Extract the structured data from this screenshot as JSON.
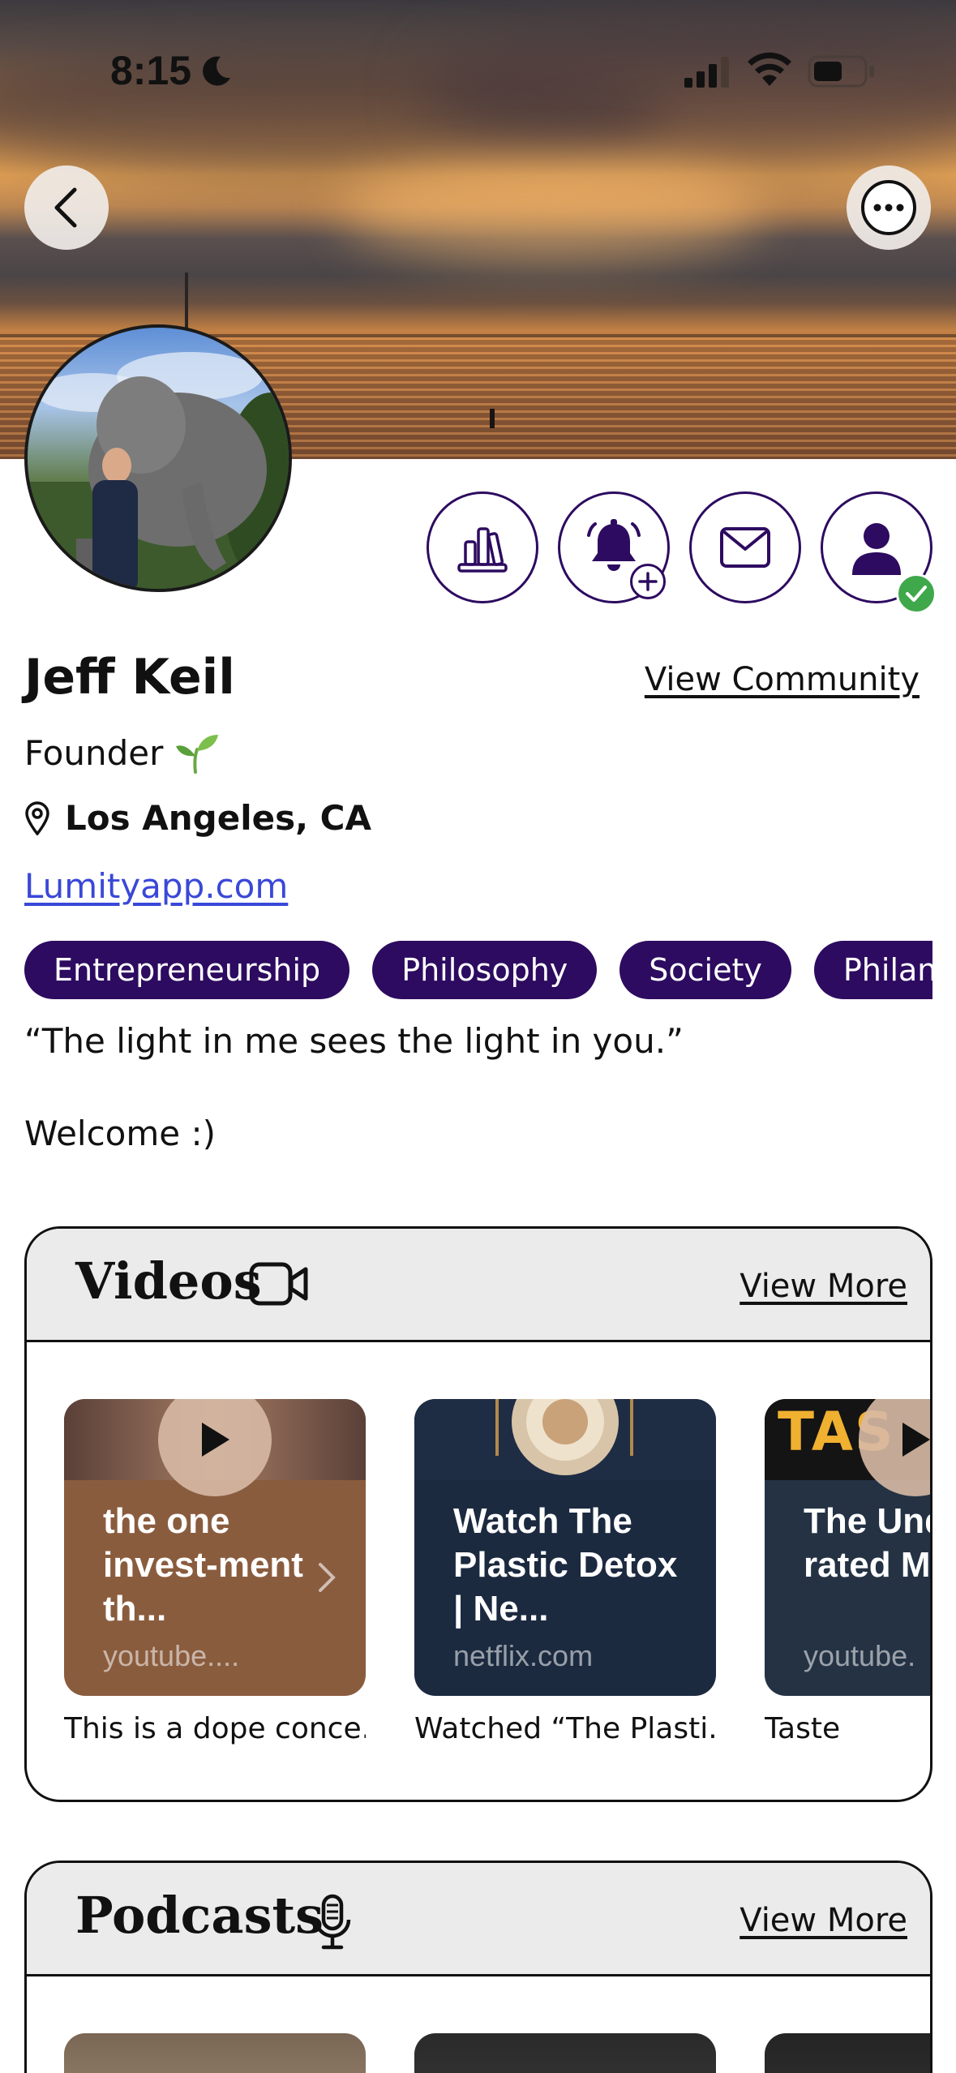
{
  "status_bar": {
    "time": "8:15"
  },
  "profile": {
    "name": "Jeff Keil",
    "view_community": "View Community",
    "title": "Founder",
    "location": "Los Angeles, CA",
    "website": "Lumityapp.com",
    "tags": [
      "Entrepreneurship",
      "Philosophy",
      "Society",
      "Philanthro"
    ],
    "bio": [
      "“The light in me sees the light in you.”",
      "Welcome :)"
    ]
  },
  "videos": {
    "title": "Videos",
    "view_more": "View More",
    "cards": [
      {
        "title": "the one invest-ment th...",
        "domain": "youtube....",
        "caption": "This is a dope conce...",
        "bg": "#8a5c3e"
      },
      {
        "title": "Watch The Plastic Detox | Ne...",
        "domain": "netflix.com",
        "caption": "Watched “The Plasti...",
        "bg": "#1c2a40"
      },
      {
        "title": "The Under-rated M",
        "domain": "youtube.",
        "caption": "Taste",
        "bg": "#243244"
      }
    ]
  },
  "podcasts": {
    "title": "Podcasts",
    "view_more": "View More"
  },
  "colors": {
    "brand": "#2d0b60",
    "link": "#3a48d8",
    "verified": "#3fa84a"
  }
}
